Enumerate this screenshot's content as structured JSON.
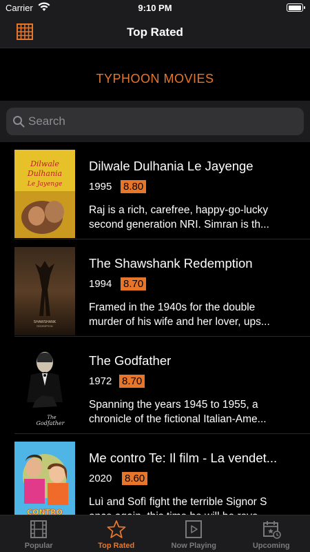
{
  "status_bar": {
    "carrier": "Carrier",
    "time": "9:10 PM"
  },
  "nav": {
    "title": "Top Rated",
    "left_icon": "grid-icon"
  },
  "brand": {
    "name": "TYPHOON MOVIES"
  },
  "search": {
    "placeholder": "Search",
    "value": ""
  },
  "movies": [
    {
      "title": "Dilwale Dulhania Le Jayenge",
      "year": "1995",
      "rating": "8.80",
      "overview_line1": "Raj is a rich, carefree, happy-go-lucky",
      "overview_line2": "second generation NRI. Simran is th...",
      "poster_text": "Dilwale Dulhania Le Jayenge"
    },
    {
      "title": "The Shawshank Redemption",
      "year": "1994",
      "rating": "8.70",
      "overview_line1": "Framed in the 1940s for the double",
      "overview_line2": "murder of his wife and her lover, ups...",
      "poster_text": "SHAWSHANK"
    },
    {
      "title": "The Godfather",
      "year": "1972",
      "rating": "8.70",
      "overview_line1": "Spanning the years 1945 to 1955, a",
      "overview_line2": "chronicle of the fictional Italian-Ame...",
      "poster_text": "The Godfather"
    },
    {
      "title": "Me contro Te: Il film - La vendet...",
      "year": "2020",
      "rating": "8.60",
      "overview_line1": "Luì and Sofì fight the terrible Signor S",
      "overview_line2": "once again, this time he will be reve...",
      "poster_text": "ME CONTRO TE IL FILM"
    }
  ],
  "tabs": [
    {
      "label": "Popular",
      "icon": "film-icon",
      "active": false
    },
    {
      "label": "Top Rated",
      "icon": "star-icon",
      "active": true
    },
    {
      "label": "Now Playing",
      "icon": "play-icon",
      "active": false
    },
    {
      "label": "Upcoming",
      "icon": "calendar-icon",
      "active": false
    }
  ],
  "colors": {
    "accent": "#e8762a",
    "background": "#000000",
    "bar": "#1c1c1e",
    "inactive_tab": "#7a7a7a"
  }
}
